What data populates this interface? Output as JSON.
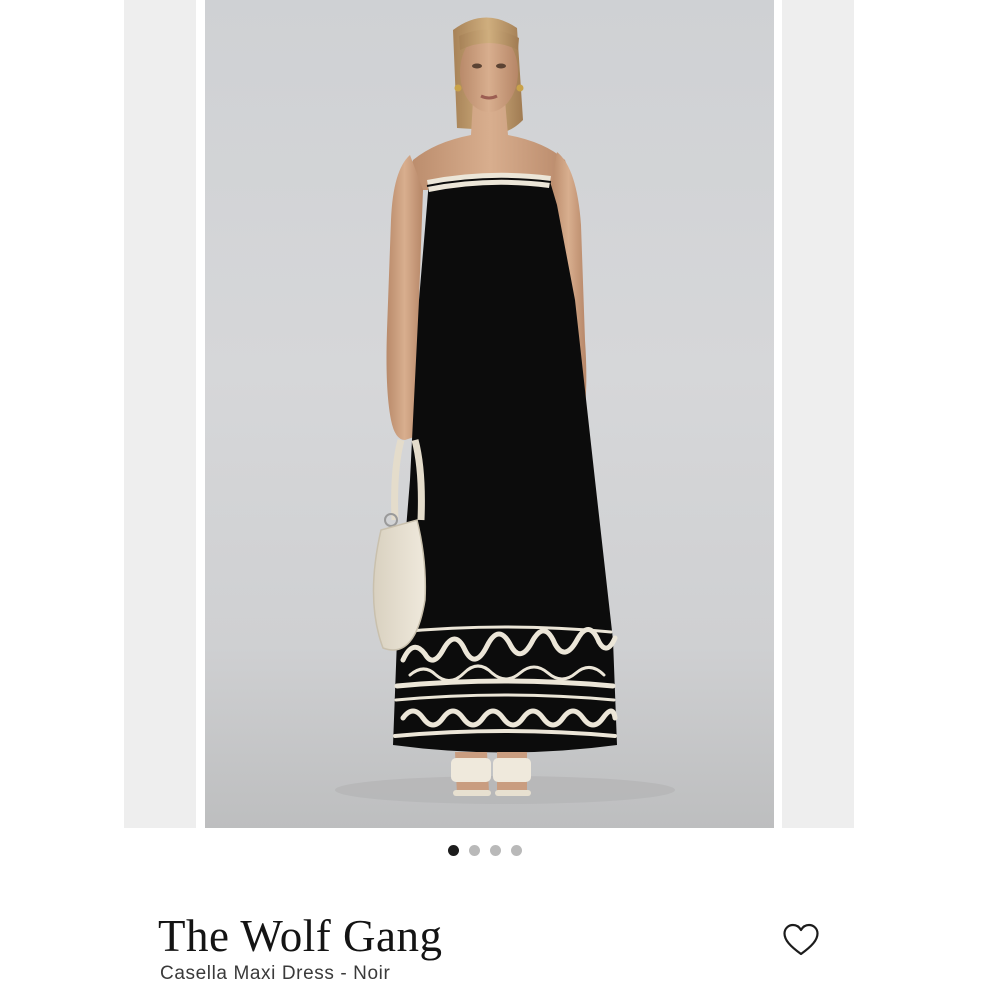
{
  "product": {
    "brand": "The Wolf Gang",
    "name": "Casella Maxi Dress - Noir"
  },
  "gallery": {
    "total_images": 4,
    "active_index": 0
  },
  "icons": {
    "wishlist": "heart-outline-icon"
  },
  "colors": {
    "dress": "#0c0c0c",
    "trim": "#ece6d8",
    "backdrop": "#d3d4d6",
    "dot_active": "#1c1c1c",
    "dot_inactive": "#b9b9b9"
  }
}
